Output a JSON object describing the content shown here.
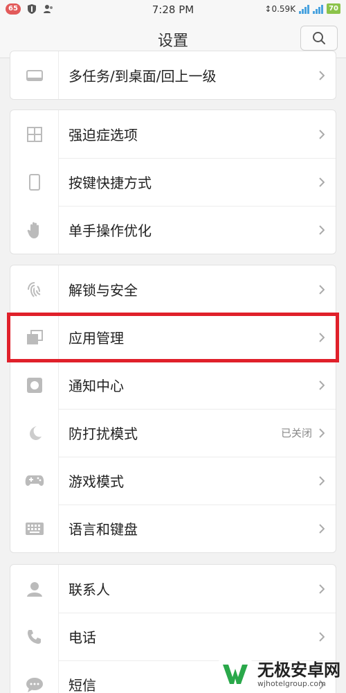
{
  "status_bar": {
    "notification_count": "65",
    "time": "7:28 PM",
    "net_speed": "↕0.59K",
    "battery": "70"
  },
  "header": {
    "title": "设置",
    "search_icon": "search-icon"
  },
  "groups": [
    {
      "rows": [
        {
          "label": "多任务/到桌面/回上一级",
          "icon": "multitask-icon"
        }
      ]
    },
    {
      "rows": [
        {
          "label": "强迫症选项",
          "icon": "grid-icon"
        },
        {
          "label": "按键快捷方式",
          "icon": "phone-outline-icon"
        },
        {
          "label": "单手操作优化",
          "icon": "hand-icon"
        }
      ]
    },
    {
      "rows": [
        {
          "label": "解锁与安全",
          "icon": "fingerprint-icon"
        },
        {
          "label": "应用管理",
          "icon": "apps-stack-icon"
        },
        {
          "label": "通知中心",
          "icon": "notification-icon"
        },
        {
          "label": "防打扰模式",
          "icon": "moon-icon",
          "value": "已关闭"
        },
        {
          "label": "游戏模式",
          "icon": "gamepad-icon"
        },
        {
          "label": "语言和键盘",
          "icon": "keyboard-icon"
        }
      ]
    },
    {
      "rows": [
        {
          "label": "联系人",
          "icon": "contact-icon"
        },
        {
          "label": "电话",
          "icon": "phone-icon"
        },
        {
          "label": "短信",
          "icon": "message-icon"
        }
      ]
    }
  ],
  "highlight": {
    "color": "#e0202a"
  },
  "watermark": {
    "title": "无极安卓网",
    "url": "wjhotelgroup.com"
  }
}
